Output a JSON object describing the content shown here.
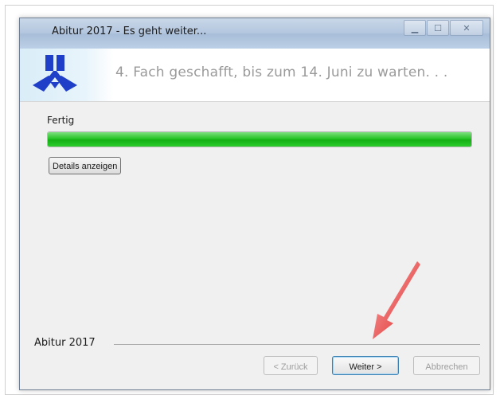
{
  "window": {
    "title": "Abitur 2017 - Es geht weiter...",
    "controls": [
      "minimize",
      "maximize",
      "close"
    ]
  },
  "banner": {
    "headline": "4. Fach geschafft, bis zum 14. Juni zu warten. . ."
  },
  "progress": {
    "status": "Fertig",
    "percent": 100,
    "details_label": "Details anzeigen"
  },
  "footer": {
    "brand": "Abitur 2017",
    "back_label": "< Zurück",
    "next_label": "Weiter >",
    "cancel_label": "Abbrechen"
  },
  "colors": {
    "progress": "#14b014",
    "arrow": "#e02020",
    "logo": "#1f3fc8"
  }
}
